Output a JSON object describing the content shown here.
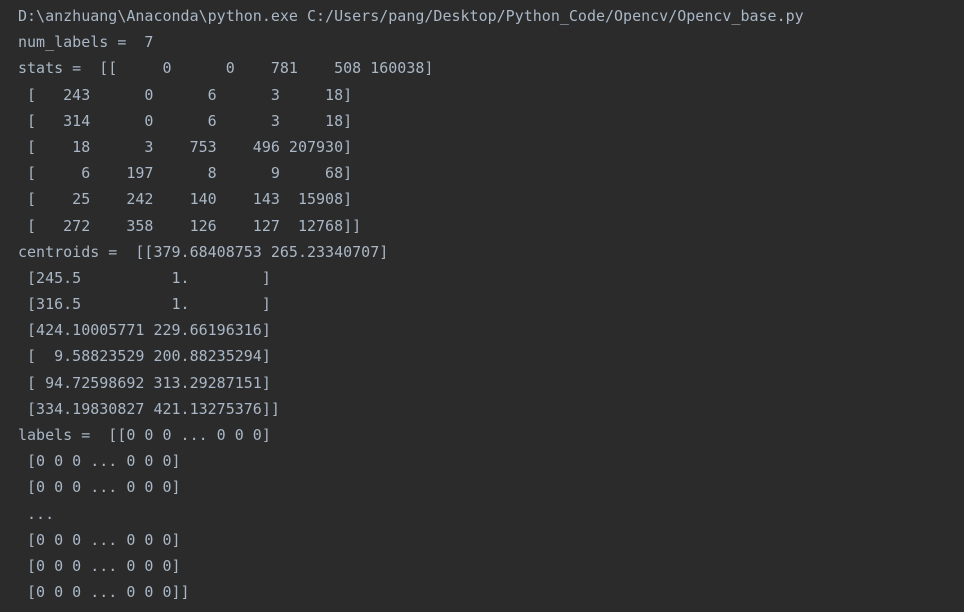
{
  "console": {
    "lines": [
      "D:\\anzhuang\\Anaconda\\python.exe C:/Users/pang/Desktop/Python_Code/Opencv/Opencv_base.py",
      "num_labels =  7",
      "stats =  [[     0      0    781    508 160038]",
      " [   243      0      6      3     18]",
      " [   314      0      6      3     18]",
      " [    18      3    753    496 207930]",
      " [     6    197      8      9     68]",
      " [    25    242    140    143  15908]",
      " [   272    358    126    127  12768]]",
      "centroids =  [[379.68408753 265.23340707]",
      " [245.5          1.        ]",
      " [316.5          1.        ]",
      " [424.10005771 229.66196316]",
      " [  9.58823529 200.88235294]",
      " [ 94.72598692 313.29287151]",
      " [334.19830827 421.13275376]]",
      "labels =  [[0 0 0 ... 0 0 0]",
      " [0 0 0 ... 0 0 0]",
      " [0 0 0 ... 0 0 0]",
      " ...",
      " [0 0 0 ... 0 0 0]",
      " [0 0 0 ... 0 0 0]",
      " [0 0 0 ... 0 0 0]]"
    ]
  },
  "colors": {
    "background": "#2b2b2b",
    "text": "#a9b7c6"
  }
}
